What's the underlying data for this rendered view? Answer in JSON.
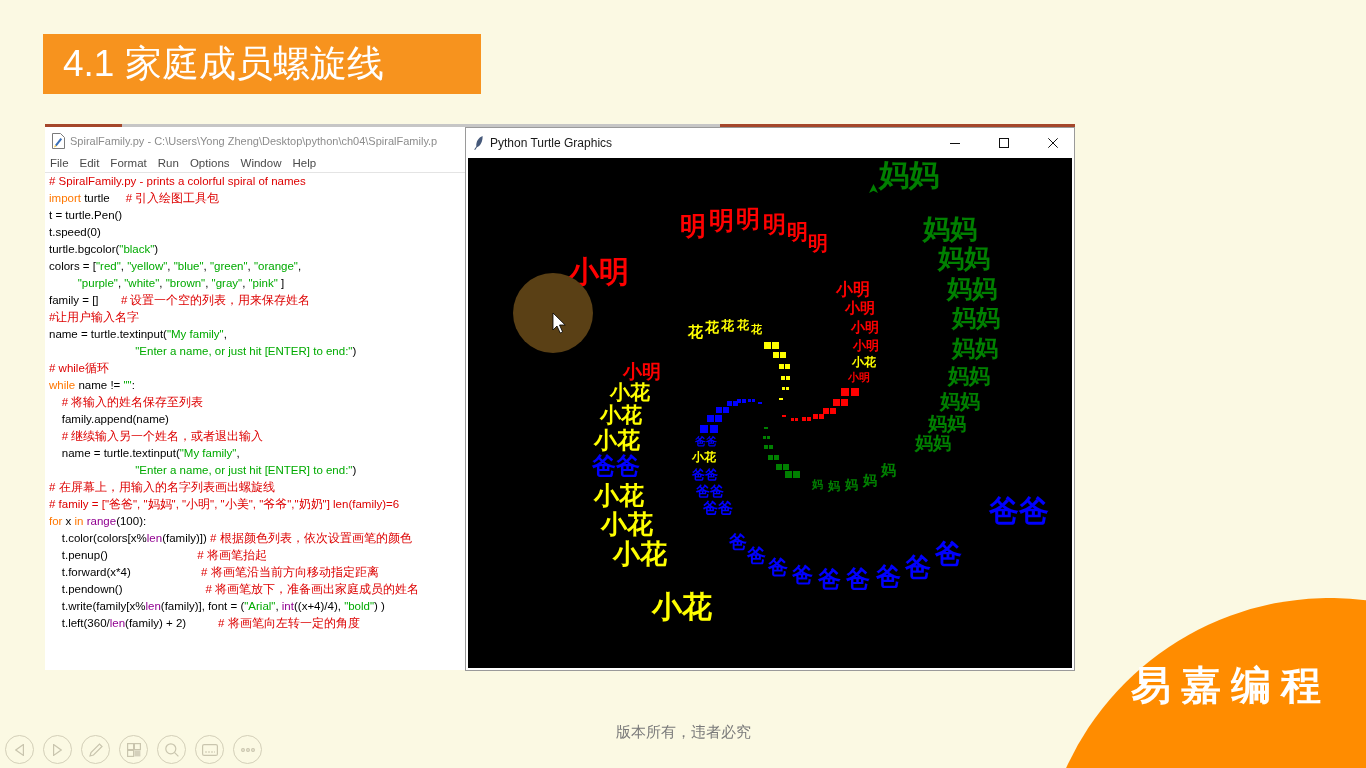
{
  "slide": {
    "title": "4.1 家庭成员螺旋线"
  },
  "editor_window": {
    "title": "SpiralFamily.py - C:\\Users\\Yong Zheng\\Desktop\\python\\ch04\\SpiralFamily.p",
    "menu": [
      "File",
      "Edit",
      "Format",
      "Run",
      "Options",
      "Window",
      "Help"
    ],
    "code_lines": [
      {
        "tokens": [
          {
            "kind": "comment",
            "text": "# SpiralFamily.py - prints a colorful spiral of names"
          }
        ]
      },
      {
        "tokens": [
          {
            "kind": "keyword",
            "text": "import"
          },
          {
            "kind": "plain",
            "text": " turtle     "
          },
          {
            "kind": "comment",
            "text": "# 引入绘图工具包"
          }
        ]
      },
      {
        "tokens": [
          {
            "kind": "plain",
            "text": "t = turtle.Pen()"
          }
        ]
      },
      {
        "tokens": [
          {
            "kind": "plain",
            "text": "t.speed(0)"
          }
        ]
      },
      {
        "tokens": [
          {
            "kind": "plain",
            "text": "turtle.bgcolor("
          },
          {
            "kind": "string",
            "text": "\"black\""
          },
          {
            "kind": "plain",
            "text": ")"
          }
        ]
      },
      {
        "tokens": [
          {
            "kind": "plain",
            "text": "colors = ["
          },
          {
            "kind": "string",
            "text": "\"red\""
          },
          {
            "kind": "plain",
            "text": ", "
          },
          {
            "kind": "string",
            "text": "\"yellow\""
          },
          {
            "kind": "plain",
            "text": ", "
          },
          {
            "kind": "string",
            "text": "\"blue\""
          },
          {
            "kind": "plain",
            "text": ", "
          },
          {
            "kind": "string",
            "text": "\"green\""
          },
          {
            "kind": "plain",
            "text": ", "
          },
          {
            "kind": "string",
            "text": "\"orange\""
          },
          {
            "kind": "plain",
            "text": ","
          }
        ]
      },
      {
        "tokens": [
          {
            "kind": "string",
            "text": "         \"purple\""
          },
          {
            "kind": "plain",
            "text": ", "
          },
          {
            "kind": "string",
            "text": "\"white\""
          },
          {
            "kind": "plain",
            "text": ", "
          },
          {
            "kind": "string",
            "text": "\"brown\""
          },
          {
            "kind": "plain",
            "text": ", "
          },
          {
            "kind": "string",
            "text": "\"gray\""
          },
          {
            "kind": "plain",
            "text": ", "
          },
          {
            "kind": "string",
            "text": "\"pink\""
          },
          {
            "kind": "plain",
            "text": " ]"
          }
        ]
      },
      {
        "tokens": [
          {
            "kind": "plain",
            "text": "family = []       "
          },
          {
            "kind": "comment",
            "text": "# 设置一个空的列表，用来保存姓名"
          }
        ]
      },
      {
        "tokens": [
          {
            "kind": "comment",
            "text": "#让用户输入名字"
          }
        ]
      },
      {
        "tokens": [
          {
            "kind": "plain",
            "text": "name = turtle.textinput("
          },
          {
            "kind": "string",
            "text": "\"My family\""
          },
          {
            "kind": "plain",
            "text": ","
          }
        ]
      },
      {
        "tokens": [
          {
            "kind": "string",
            "text": "                           \"Enter a name, or just hit [ENTER] to end:\""
          },
          {
            "kind": "plain",
            "text": ")"
          }
        ]
      },
      {
        "tokens": [
          {
            "kind": "comment",
            "text": "# while循环"
          }
        ]
      },
      {
        "tokens": [
          {
            "kind": "keyword",
            "text": "while"
          },
          {
            "kind": "plain",
            "text": " name != "
          },
          {
            "kind": "string",
            "text": "\"\""
          },
          {
            "kind": "plain",
            "text": ":"
          }
        ]
      },
      {
        "tokens": [
          {
            "kind": "comment",
            "text": "    # 将输入的姓名保存至列表"
          }
        ]
      },
      {
        "tokens": [
          {
            "kind": "plain",
            "text": "    family.append(name)"
          }
        ]
      },
      {
        "tokens": [
          {
            "kind": "comment",
            "text": "    # 继续输入另一个姓名，或者退出输入"
          }
        ]
      },
      {
        "tokens": [
          {
            "kind": "plain",
            "text": "    name = turtle.textinput("
          },
          {
            "kind": "string",
            "text": "\"My family\""
          },
          {
            "kind": "plain",
            "text": ","
          }
        ]
      },
      {
        "tokens": [
          {
            "kind": "string",
            "text": "                           \"Enter a name, or just hit [ENTER] to end:\""
          },
          {
            "kind": "plain",
            "text": ")"
          }
        ]
      },
      {
        "tokens": [
          {
            "kind": "comment",
            "text": "# 在屏幕上，用输入的名字列表画出螺旋线"
          }
        ]
      },
      {
        "tokens": [
          {
            "kind": "comment",
            "text": "# family = [\"爸爸\", \"妈妈\", \"小明\", \"小美\", \"爷爷\",\"奶奶\"] len(family)=6"
          }
        ]
      },
      {
        "tokens": [
          {
            "kind": "keyword",
            "text": "for"
          },
          {
            "kind": "plain",
            "text": " x "
          },
          {
            "kind": "keyword",
            "text": "in"
          },
          {
            "kind": "builtin",
            "text": " range"
          },
          {
            "kind": "plain",
            "text": "(100):"
          }
        ]
      },
      {
        "tokens": [
          {
            "kind": "plain",
            "text": "    t.color(colors[x%"
          },
          {
            "kind": "builtin",
            "text": "len"
          },
          {
            "kind": "plain",
            "text": "(family)]) "
          },
          {
            "kind": "comment",
            "text": "# 根据颜色列表，依次设置画笔的颜色"
          }
        ]
      },
      {
        "tokens": [
          {
            "kind": "plain",
            "text": "    t.penup()                            "
          },
          {
            "kind": "comment",
            "text": "# 将画笔抬起"
          }
        ]
      },
      {
        "tokens": [
          {
            "kind": "plain",
            "text": "    t.forward(x*4)                      "
          },
          {
            "kind": "comment",
            "text": "# 将画笔沿当前方向移动指定距离"
          }
        ]
      },
      {
        "tokens": [
          {
            "kind": "plain",
            "text": "    t.pendown()                          "
          },
          {
            "kind": "comment",
            "text": "# 将画笔放下，准备画出家庭成员的姓名"
          }
        ]
      },
      {
        "tokens": [
          {
            "kind": "plain",
            "text": "    t.write(family[x%"
          },
          {
            "kind": "builtin",
            "text": "len"
          },
          {
            "kind": "plain",
            "text": "(family)], font = ("
          },
          {
            "kind": "string",
            "text": "\"Arial\""
          },
          {
            "kind": "plain",
            "text": ", "
          },
          {
            "kind": "builtin",
            "text": "int"
          },
          {
            "kind": "plain",
            "text": "((x+4)/4), "
          },
          {
            "kind": "string",
            "text": "\"bold\""
          },
          {
            "kind": "plain",
            "text": ") )"
          }
        ]
      },
      {
        "tokens": [
          {
            "kind": "plain",
            "text": "    t.left(360/"
          },
          {
            "kind": "builtin",
            "text": "len"
          },
          {
            "kind": "plain",
            "text": "(family) + 2)          "
          },
          {
            "kind": "comment",
            "text": "# 将画笔向左转一定的角度"
          }
        ]
      }
    ]
  },
  "turtle_window": {
    "title": "Python Turtle Graphics",
    "canvas": {
      "labels": [
        {
          "text": "妈妈",
          "color": "#008000"
        },
        {
          "text": "明",
          "color": "#ff0000"
        },
        {
          "text": "明",
          "color": "#ff0000"
        },
        {
          "text": "明",
          "color": "#ff0000"
        },
        {
          "text": "明",
          "color": "#ff0000"
        },
        {
          "text": "明",
          "color": "#ff0000"
        },
        {
          "text": "妈妈",
          "color": "#008000"
        },
        {
          "text": "明",
          "color": "#ff0000"
        },
        {
          "text": "小明",
          "color": "#ff0000"
        },
        {
          "text": "妈妈",
          "color": "#008000"
        },
        {
          "text": "小明",
          "color": "#ff0000"
        },
        {
          "text": "妈妈",
          "color": "#008000"
        },
        {
          "text": "小明",
          "color": "#ff0000"
        },
        {
          "text": "花",
          "color": "#ffff00"
        },
        {
          "text": "花",
          "color": "#ffff00"
        },
        {
          "text": "花",
          "color": "#ffff00"
        },
        {
          "text": "花",
          "color": "#ffff00"
        },
        {
          "text": "小明",
          "color": "#ff0000"
        },
        {
          "text": "妈妈",
          "color": "#008000"
        },
        {
          "text": "花",
          "color": "#ffff00"
        },
        {
          "text": "小明",
          "color": "#ff0000"
        },
        {
          "text": "妈妈",
          "color": "#008000"
        },
        {
          "text": "小明",
          "color": "#ff0000"
        },
        {
          "text": "小花",
          "color": "#ffff00"
        },
        {
          "text": "小明",
          "color": "#ff0000"
        },
        {
          "text": "妈妈",
          "color": "#008000"
        },
        {
          "text": "小花",
          "color": "#ffff00"
        },
        {
          "text": "妈妈",
          "color": "#008000"
        },
        {
          "text": "小花",
          "color": "#ffff00"
        },
        {
          "text": "妈妈",
          "color": "#008000"
        },
        {
          "text": "小花",
          "color": "#ffff00"
        },
        {
          "text": "爸爸",
          "color": "#0000ff"
        },
        {
          "text": "妈妈",
          "color": "#008000"
        },
        {
          "text": "爸爸",
          "color": "#0000ff"
        },
        {
          "text": "小花",
          "color": "#ffff00"
        },
        {
          "text": "爸爸",
          "color": "#0000ff"
        },
        {
          "text": "妈",
          "color": "#008000"
        },
        {
          "text": "妈",
          "color": "#008000"
        },
        {
          "text": "妈",
          "color": "#008000"
        },
        {
          "text": "妈",
          "color": "#008000"
        },
        {
          "text": "妈",
          "color": "#008000"
        },
        {
          "text": "小花",
          "color": "#ffff00"
        },
        {
          "text": "爸爸",
          "color": "#0000ff"
        },
        {
          "text": "小花",
          "color": "#ffff00"
        },
        {
          "text": "爸爸",
          "color": "#0000ff"
        },
        {
          "text": "爸爸",
          "color": "#0000ff"
        },
        {
          "text": "小花",
          "color": "#ffff00"
        },
        {
          "text": "爸",
          "color": "#0000ff"
        },
        {
          "text": "爸",
          "color": "#0000ff"
        },
        {
          "text": "爸",
          "color": "#0000ff"
        },
        {
          "text": "爸",
          "color": "#0000ff"
        },
        {
          "text": "爸",
          "color": "#0000ff"
        },
        {
          "text": "爸",
          "color": "#0000ff"
        },
        {
          "text": "爸",
          "color": "#0000ff"
        },
        {
          "text": "爸",
          "color": "#0000ff"
        },
        {
          "text": "爸",
          "color": "#0000ff"
        },
        {
          "text": "小花",
          "color": "#ffff00"
        }
      ]
    }
  },
  "footer": {
    "notice": "版本所有，违者必究"
  },
  "slideshow_controls": [
    {
      "kind": "previous"
    },
    {
      "kind": "next"
    },
    {
      "kind": "pen"
    },
    {
      "kind": "slides"
    },
    {
      "kind": "zoom"
    },
    {
      "kind": "subtitles"
    },
    {
      "kind": "more"
    }
  ],
  "brand": {
    "name": "易嘉编程"
  }
}
